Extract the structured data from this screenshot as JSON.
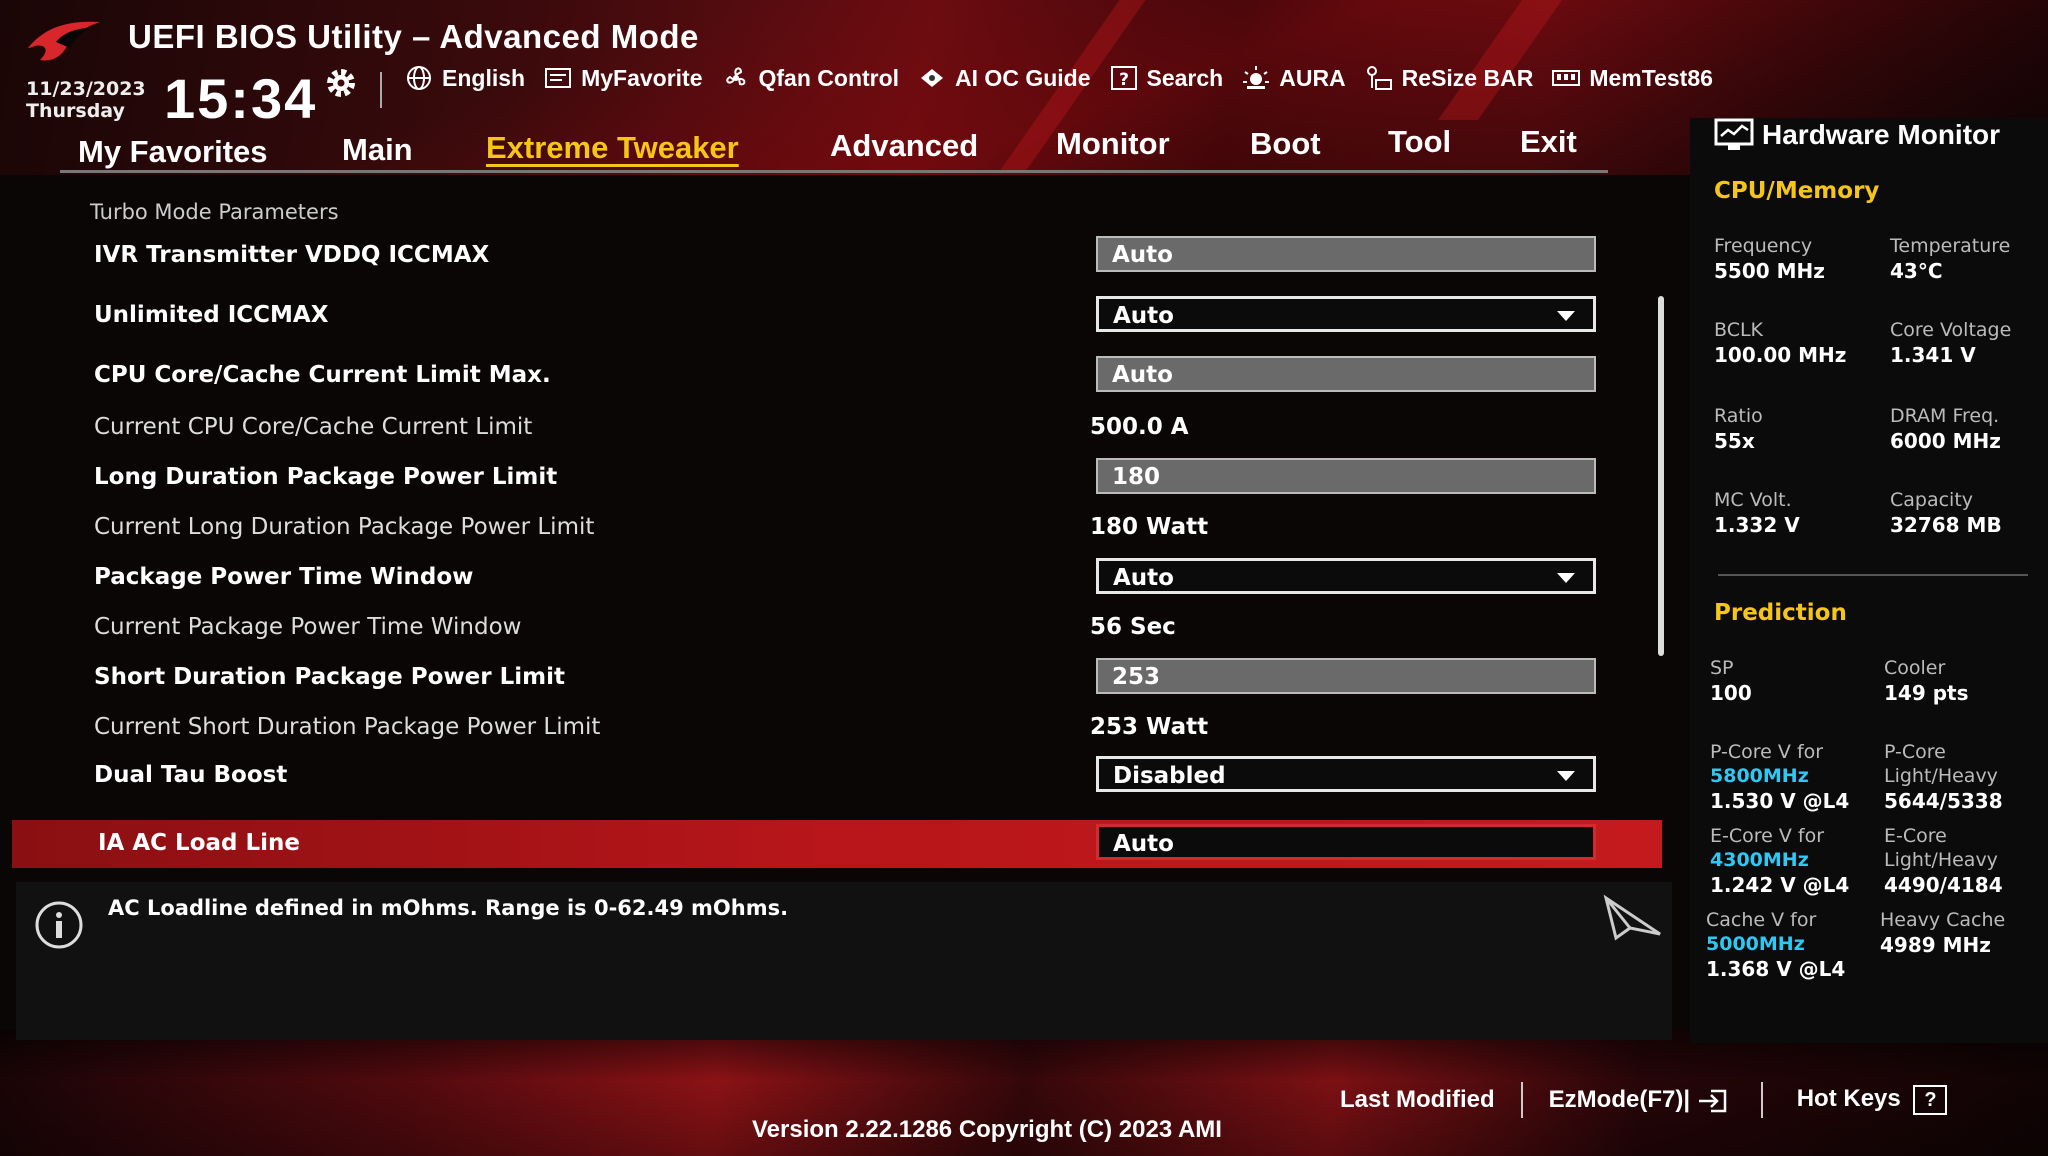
{
  "colors": {
    "accent": "#f5c518",
    "highlight_row": "#c41a1e",
    "link_blue": "#2ec8f5"
  },
  "header": {
    "title": "UEFI BIOS Utility – Advanced Mode",
    "date": "11/23/2023",
    "day": "Thursday",
    "time": "15:34",
    "toolbar": [
      {
        "label": "English",
        "icon": "globe-icon"
      },
      {
        "label": "MyFavorite",
        "icon": "favorite-icon"
      },
      {
        "label": "Qfan Control",
        "icon": "fan-icon"
      },
      {
        "label": "AI OC Guide",
        "icon": "ai-oc-icon"
      },
      {
        "label": "Search",
        "icon": "search-help-icon"
      },
      {
        "label": "AURA",
        "icon": "aura-icon"
      },
      {
        "label": "ReSize BAR",
        "icon": "resize-bar-icon"
      },
      {
        "label": "MemTest86",
        "icon": "memtest-icon"
      }
    ]
  },
  "tabs": [
    {
      "label": "My Favorites"
    },
    {
      "label": "Main"
    },
    {
      "label": "Extreme Tweaker"
    },
    {
      "label": "Advanced"
    },
    {
      "label": "Monitor"
    },
    {
      "label": "Boot"
    },
    {
      "label": "Tool"
    },
    {
      "label": "Exit"
    }
  ],
  "active_tab": "Extreme Tweaker",
  "settings": {
    "section_title": "Turbo Mode Parameters",
    "rows": [
      {
        "label": "IVR Transmitter VDDQ ICCMAX",
        "value": "Auto",
        "kind": "field"
      },
      {
        "label": "Unlimited ICCMAX",
        "value": "Auto",
        "kind": "select"
      },
      {
        "label": "CPU Core/Cache Current Limit Max.",
        "value": "Auto",
        "kind": "field"
      },
      {
        "label": "Current CPU Core/Cache Current Limit",
        "value": "500.0 A",
        "kind": "info"
      },
      {
        "label": "Long Duration Package Power Limit",
        "value": "180",
        "kind": "field"
      },
      {
        "label": "Current Long Duration Package Power Limit",
        "value": "180 Watt",
        "kind": "info"
      },
      {
        "label": "Package Power Time Window",
        "value": "Auto",
        "kind": "select"
      },
      {
        "label": "Current Package Power Time Window",
        "value": "56 Sec",
        "kind": "info"
      },
      {
        "label": "Short Duration Package Power Limit",
        "value": "253",
        "kind": "field"
      },
      {
        "label": "Current Short Duration Package Power Limit",
        "value": "253 Watt",
        "kind": "info"
      },
      {
        "label": "Dual Tau Boost",
        "value": "Disabled",
        "kind": "select"
      },
      {
        "label": "IA AC Load Line",
        "value": "Auto",
        "kind": "field",
        "selected": true
      }
    ]
  },
  "help": {
    "text": "AC Loadline defined in mOhms. Range is 0-62.49 mOhms."
  },
  "hardware_monitor": {
    "title": "Hardware Monitor",
    "cpu_memory": {
      "title": "CPU/Memory",
      "frequency_label": "Frequency",
      "frequency": "5500 MHz",
      "temperature_label": "Temperature",
      "temperature": "43°C",
      "bclk_label": "BCLK",
      "bclk": "100.00 MHz",
      "core_voltage_label": "Core Voltage",
      "core_voltage": "1.341 V",
      "ratio_label": "Ratio",
      "ratio": "55x",
      "dram_freq_label": "DRAM Freq.",
      "dram_freq": "6000 MHz",
      "mc_volt_label": "MC Volt.",
      "mc_volt": "1.332 V",
      "capacity_label": "Capacity",
      "capacity": "32768 MB"
    },
    "prediction": {
      "title": "Prediction",
      "sp_label": "SP",
      "sp": "100",
      "cooler_label": "Cooler",
      "cooler": "149 pts",
      "pcore_v_label": "P-Core V for",
      "pcore_v_freq": "5800MHz",
      "pcore_v": "1.530 V @L4",
      "pcore_lh_label1": "P-Core",
      "pcore_lh_label2": "Light/Heavy",
      "pcore_lh": "5644/5338",
      "ecore_v_label": "E-Core V for",
      "ecore_v_freq": "4300MHz",
      "ecore_v": "1.242 V @L4",
      "ecore_lh_label1": "E-Core",
      "ecore_lh_label2": "Light/Heavy",
      "ecore_lh": "4490/4184",
      "cache_v_label": "Cache V for",
      "cache_v_freq": "5000MHz",
      "cache_v": "1.368 V @L4",
      "heavy_cache_label": "Heavy Cache",
      "heavy_cache": "4989 MHz"
    }
  },
  "footer": {
    "last_modified": "Last Modified",
    "ezmode": "EzMode(F7)|",
    "hot_keys": "Hot Keys",
    "hot_keys_key": "?",
    "version": "Version 2.22.1286 Copyright (C) 2023 AMI"
  }
}
